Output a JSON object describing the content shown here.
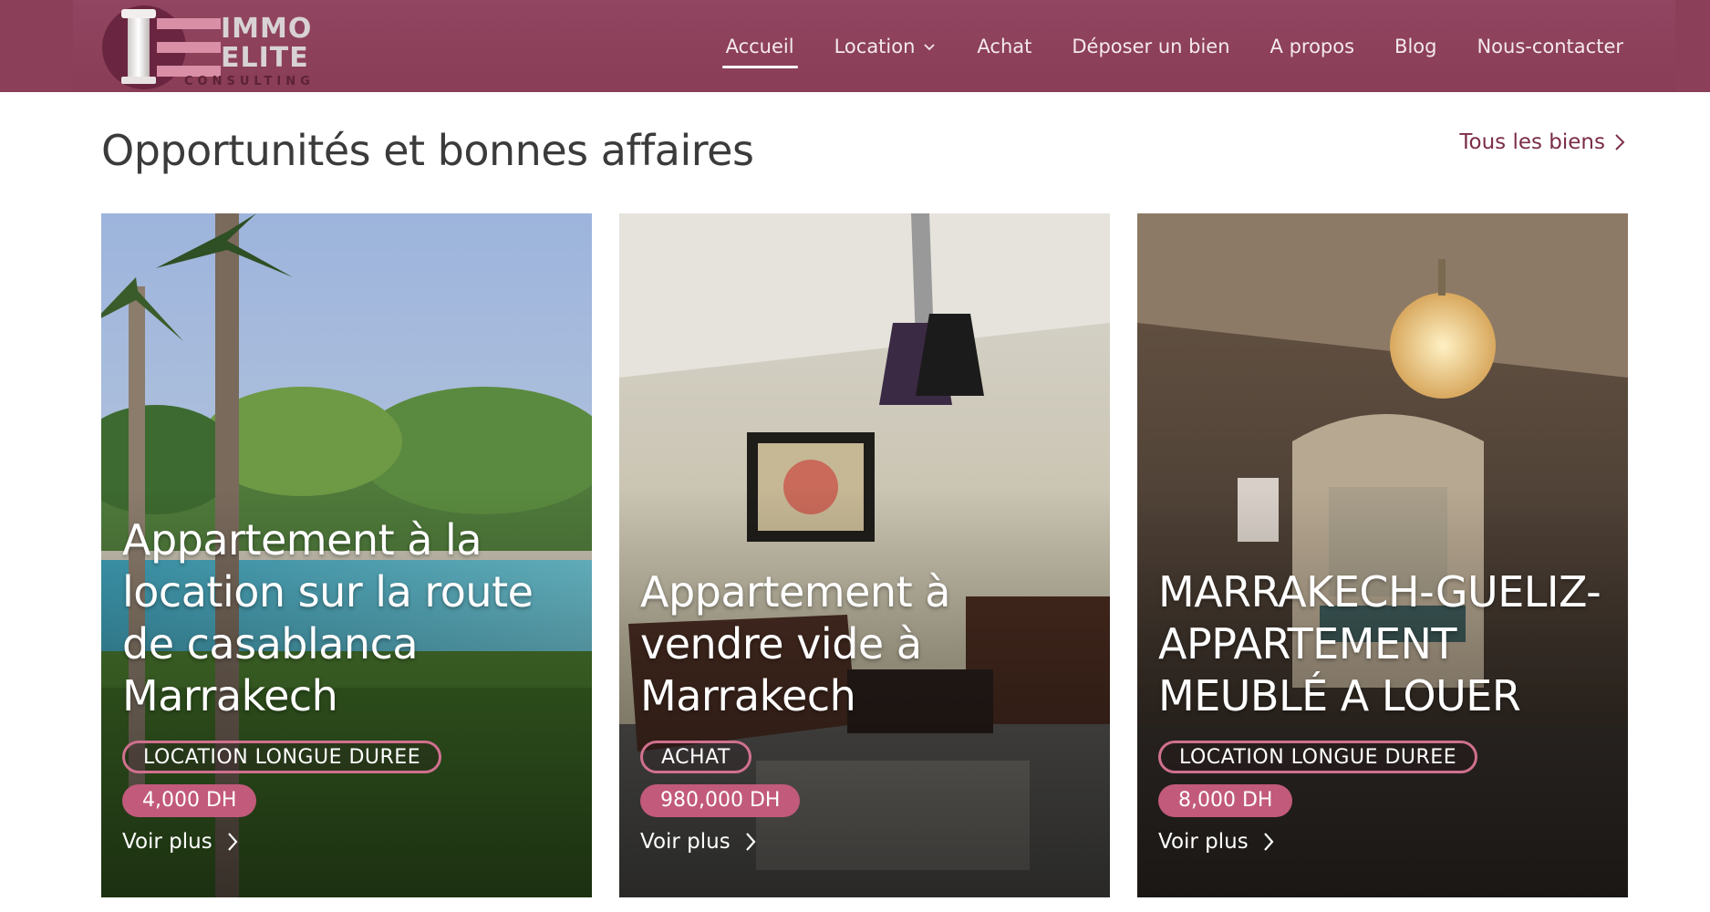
{
  "brand": {
    "logo_line1": "IMMO",
    "logo_line2": "ELITE",
    "logo_line3": "CONSULTING"
  },
  "nav": {
    "items": [
      {
        "label": "Accueil",
        "active": true
      },
      {
        "label": "Location",
        "dropdown": true
      },
      {
        "label": "Achat"
      },
      {
        "label": "Déposer un bien"
      },
      {
        "label": "A propos"
      },
      {
        "label": "Blog"
      },
      {
        "label": "Nous-contacter"
      }
    ]
  },
  "section": {
    "title": "Opportunités et bonnes affaires",
    "all_link": "Tous les biens"
  },
  "cards": [
    {
      "title": "Appartement à la location sur la route de casablanca Marrakech",
      "tag": "LOCATION LONGUE DUREE",
      "price": "4,000 DH",
      "more": "Voir plus"
    },
    {
      "title": "Appartement à vendre vide à Marrakech",
      "tag": "ACHAT",
      "price": "980,000 DH",
      "more": "Voir plus"
    },
    {
      "title": "MARRAKECH-GUELIZ-APPARTEMENT MEUBLÉ A LOUER",
      "tag": "LOCATION LONGUE DUREE",
      "price": "8,000 DH",
      "more": "Voir plus"
    }
  ],
  "colors": {
    "header": "#8c3f58",
    "accent": "#7b2d47",
    "tag_border": "#d0708f",
    "price_bg": "#c25a7b"
  }
}
